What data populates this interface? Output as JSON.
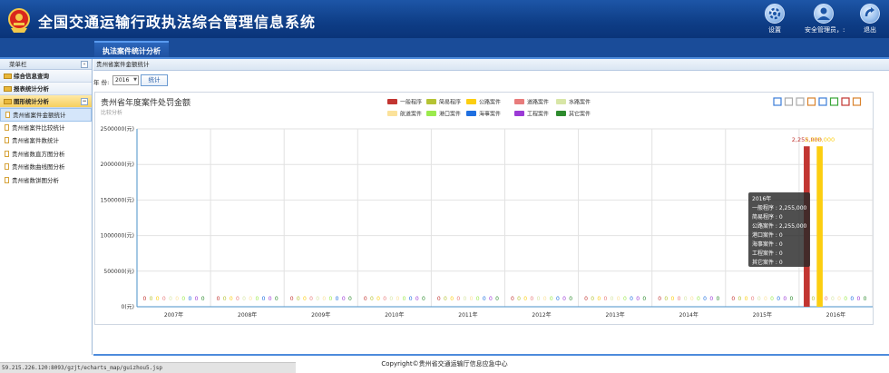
{
  "header": {
    "title": "全国交通运输行政执法综合管理信息系统",
    "buttons": [
      {
        "icon": "gear-icon",
        "label": "设置"
      },
      {
        "icon": "user-icon",
        "label": "安全管理员，:"
      },
      {
        "icon": "exit-icon",
        "label": "退出"
      }
    ],
    "colors": {
      "bar": "#0e3d86",
      "accent": "#4d8bdc"
    }
  },
  "tabs": [
    {
      "label": "执法案件统计分析",
      "active": true
    }
  ],
  "sidebar": {
    "title": "菜单栏",
    "collapse_label": "«",
    "groups": [
      {
        "label": "综合信息查询",
        "expanded": false
      },
      {
        "label": "报表统计分析",
        "expanded": false
      },
      {
        "label": "图形统计分析",
        "expanded": true,
        "toggle": "−"
      }
    ],
    "items": [
      {
        "label": "贵州省案件金额统计",
        "active": true
      },
      {
        "label": "贵州省案件比较统计",
        "active": false
      },
      {
        "label": "贵州省案件数统计",
        "active": false
      },
      {
        "label": "贵州省数直方图分析",
        "active": false
      },
      {
        "label": "贵州省数曲线图分析",
        "active": false
      },
      {
        "label": "贵州省数饼图分析",
        "active": false
      }
    ]
  },
  "breadcrumb": "贵州省案件金额统计",
  "filter": {
    "year_label": "年 份:",
    "year_value": "2016",
    "button_label": "统计"
  },
  "toolbar_icons": [
    "mark-icon",
    "erase-icon",
    "zoom-reset-icon",
    "data-view-icon",
    "line-chart-icon",
    "bar-chart-icon",
    "refresh-icon",
    "save-image-icon"
  ],
  "chart_data": {
    "type": "bar",
    "title": "贵州省年度案件处罚金额",
    "subtitle": "比较分析",
    "categories": [
      "2007年",
      "2008年",
      "2009年",
      "2010年",
      "2011年",
      "2012年",
      "2013年",
      "2014年",
      "2015年",
      "2016年"
    ],
    "ylim": [
      0,
      2500000
    ],
    "yticks": [
      "0(元)",
      "500000(元)",
      "1000000(元)",
      "1500000(元)",
      "2000000(元)",
      "2500000(元)"
    ],
    "legend_position": "top",
    "grid": true,
    "series": [
      {
        "name": "一般程序",
        "color": "#c23531",
        "values": [
          0,
          0,
          0,
          0,
          0,
          0,
          0,
          0,
          0,
          2255000
        ]
      },
      {
        "name": "简易程序",
        "color": "#b5c334",
        "values": [
          0,
          0,
          0,
          0,
          0,
          0,
          0,
          0,
          0,
          0
        ]
      },
      {
        "name": "公路案件",
        "color": "#fcce10",
        "values": [
          0,
          0,
          0,
          0,
          0,
          0,
          0,
          0,
          0,
          2255000
        ]
      },
      {
        "name": "道路案件",
        "color": "#e87c7c",
        "values": [
          0,
          0,
          0,
          0,
          0,
          0,
          0,
          0,
          0,
          0
        ]
      },
      {
        "name": "水路案件",
        "color": "#d8e6a7",
        "values": [
          0,
          0,
          0,
          0,
          0,
          0,
          0,
          0,
          0,
          0
        ]
      },
      {
        "name": "航道案件",
        "color": "#fbe29b",
        "values": [
          0,
          0,
          0,
          0,
          0,
          0,
          0,
          0,
          0,
          0
        ]
      },
      {
        "name": "港口案件",
        "color": "#9bea4d",
        "values": [
          0,
          0,
          0,
          0,
          0,
          0,
          0,
          0,
          0,
          0
        ]
      },
      {
        "name": "海事案件",
        "color": "#1f6fe0",
        "values": [
          0,
          0,
          0,
          0,
          0,
          0,
          0,
          0,
          0,
          0
        ]
      },
      {
        "name": "工程案件",
        "color": "#9b3ad6",
        "values": [
          0,
          0,
          0,
          0,
          0,
          0,
          0,
          0,
          0,
          0
        ]
      },
      {
        "name": "其它案件",
        "color": "#2e8b2e",
        "values": [
          0,
          0,
          0,
          0,
          0,
          0,
          0,
          0,
          0,
          0
        ]
      }
    ],
    "bar_labels": [
      "2,255,000",
      "2,255,000"
    ],
    "tooltip": {
      "title": "2016年",
      "lines": [
        "一般程序 : 2,255,000",
        "简易程序 : 0",
        "公路案件 : 2,255,000",
        "港口案件 : 0",
        "海事案件 : 0",
        "工程案件 : 0",
        "其它案件 : 0"
      ]
    }
  },
  "footer": {
    "copyright": "Copyright©贵州省交通运输厅信息应急中心",
    "status_url": "59.215.226.120:8093/gzjt/echarts_map/guizhou5.jsp"
  }
}
